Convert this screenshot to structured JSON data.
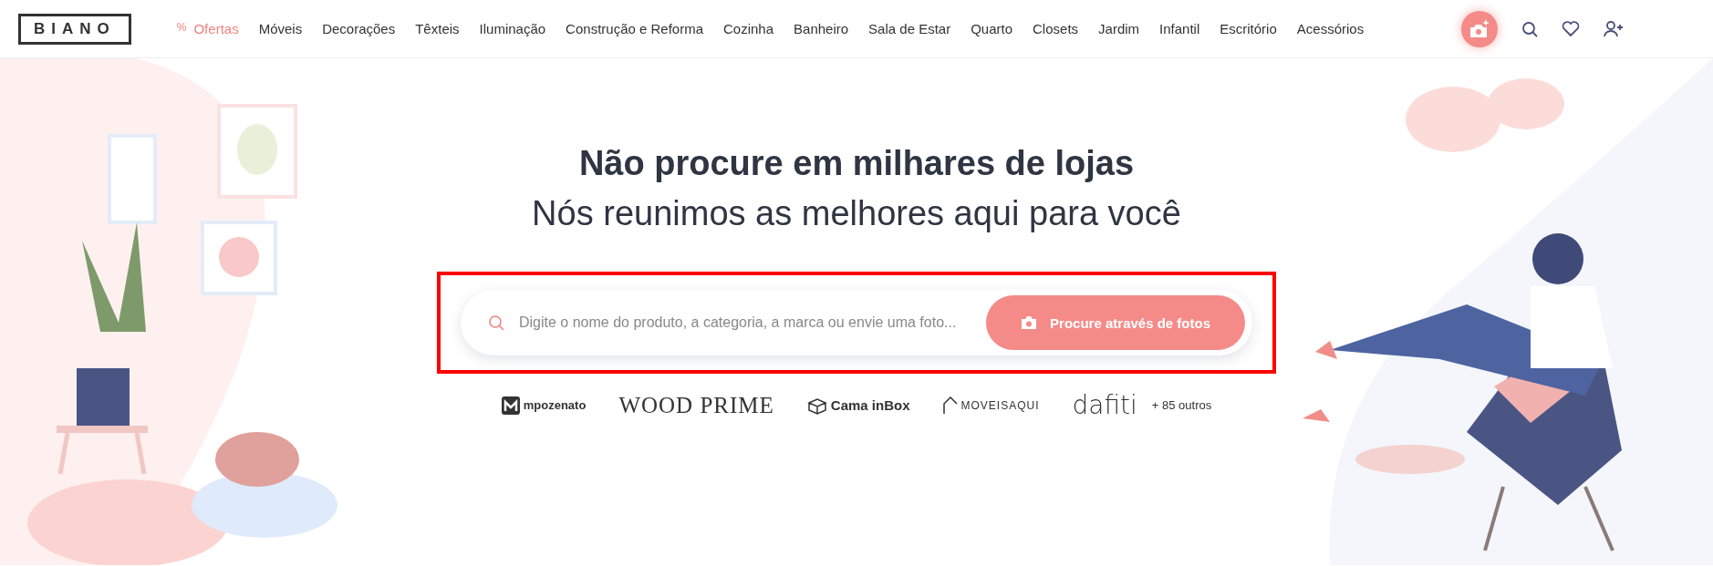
{
  "header": {
    "logo": "BIANO",
    "nav": [
      {
        "label": "Ofertas",
        "kind": "deal",
        "icon": "%"
      },
      {
        "label": "Móveis",
        "kind": "link"
      },
      {
        "label": "Decorações",
        "kind": "link"
      },
      {
        "label": "Têxteis",
        "kind": "link"
      },
      {
        "label": "Iluminação",
        "kind": "link"
      },
      {
        "label": "Construção e Reforma",
        "kind": "link"
      },
      {
        "label": "Cozinha",
        "kind": "link"
      },
      {
        "label": "Banheiro",
        "kind": "link"
      },
      {
        "label": "Sala de Estar",
        "kind": "link"
      },
      {
        "label": "Quarto",
        "kind": "link"
      },
      {
        "label": "Closets",
        "kind": "link"
      },
      {
        "label": "Jardim",
        "kind": "link"
      },
      {
        "label": "Infantil",
        "kind": "link"
      },
      {
        "label": "Escritório",
        "kind": "link"
      },
      {
        "label": "Acessórios",
        "kind": "link"
      }
    ]
  },
  "hero": {
    "title": "Não procure em milhares de lojas",
    "subtitle": "Nós reunimos as melhores aqui para você",
    "search": {
      "placeholder": "Digite o nome do produto, a categoria, a marca ou envie uma foto...",
      "button": "Procure através de fotos",
      "highlighted": true
    },
    "brands": [
      {
        "name": "mpozenato",
        "kind": "mark"
      },
      {
        "name": "WOOD PRIME",
        "kind": "serif"
      },
      {
        "name": "Cama inBox",
        "kind": "box"
      },
      {
        "name": "MOVEISAQUI",
        "kind": "house"
      },
      {
        "name": "dafiti",
        "kind": "light"
      }
    ],
    "more": "+ 85 outros"
  }
}
